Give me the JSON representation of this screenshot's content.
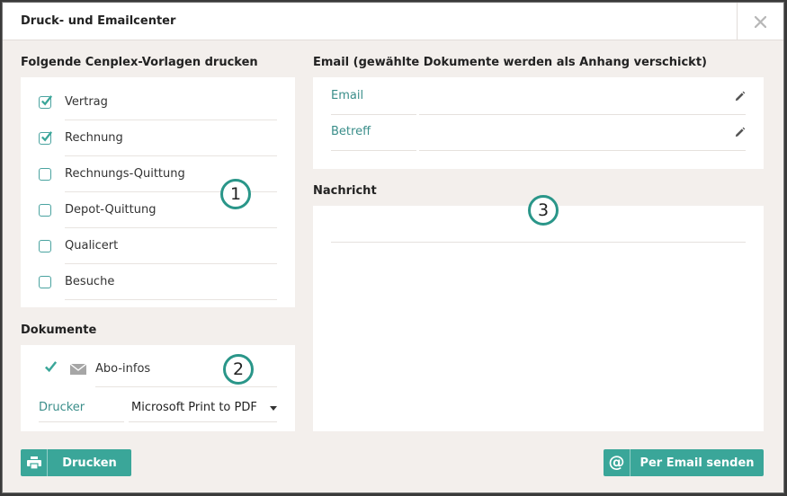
{
  "dialog": {
    "title": "Druck- und Emailcenter"
  },
  "templates": {
    "heading": "Folgende Cenplex-Vorlagen drucken",
    "items": [
      {
        "label": "Vertrag",
        "checked": true
      },
      {
        "label": "Rechnung",
        "checked": true
      },
      {
        "label": "Rechnungs-Quittung",
        "checked": false
      },
      {
        "label": "Depot-Quittung",
        "checked": false
      },
      {
        "label": "Qualicert",
        "checked": false
      },
      {
        "label": "Besuche",
        "checked": false
      }
    ]
  },
  "documents": {
    "heading": "Dokumente",
    "item_label": "Abo-infos",
    "item_checked": true,
    "printer_label": "Drucker",
    "printer_value": "Microsoft Print to PDF"
  },
  "email": {
    "heading": "Email (gewählte Dokumente werden als Anhang verschickt)",
    "email_label": "Email",
    "email_value": "",
    "subject_label": "Betreff",
    "subject_value": ""
  },
  "message": {
    "heading": "Nachricht",
    "value": ""
  },
  "badges": {
    "one": "1",
    "two": "2",
    "three": "3"
  },
  "buttons": {
    "print_label": "Drucken",
    "email_label": "Per Email senden"
  },
  "colors": {
    "accent": "#3aa699",
    "label_teal": "#3a8e8a",
    "background": "#f3efec"
  },
  "icons": {
    "close": "close-icon",
    "check": "check-icon",
    "envelope": "envelope-icon",
    "pencil": "pencil-icon",
    "printer": "printer-icon",
    "at": "at-icon",
    "dropdown": "caret-down-icon"
  }
}
